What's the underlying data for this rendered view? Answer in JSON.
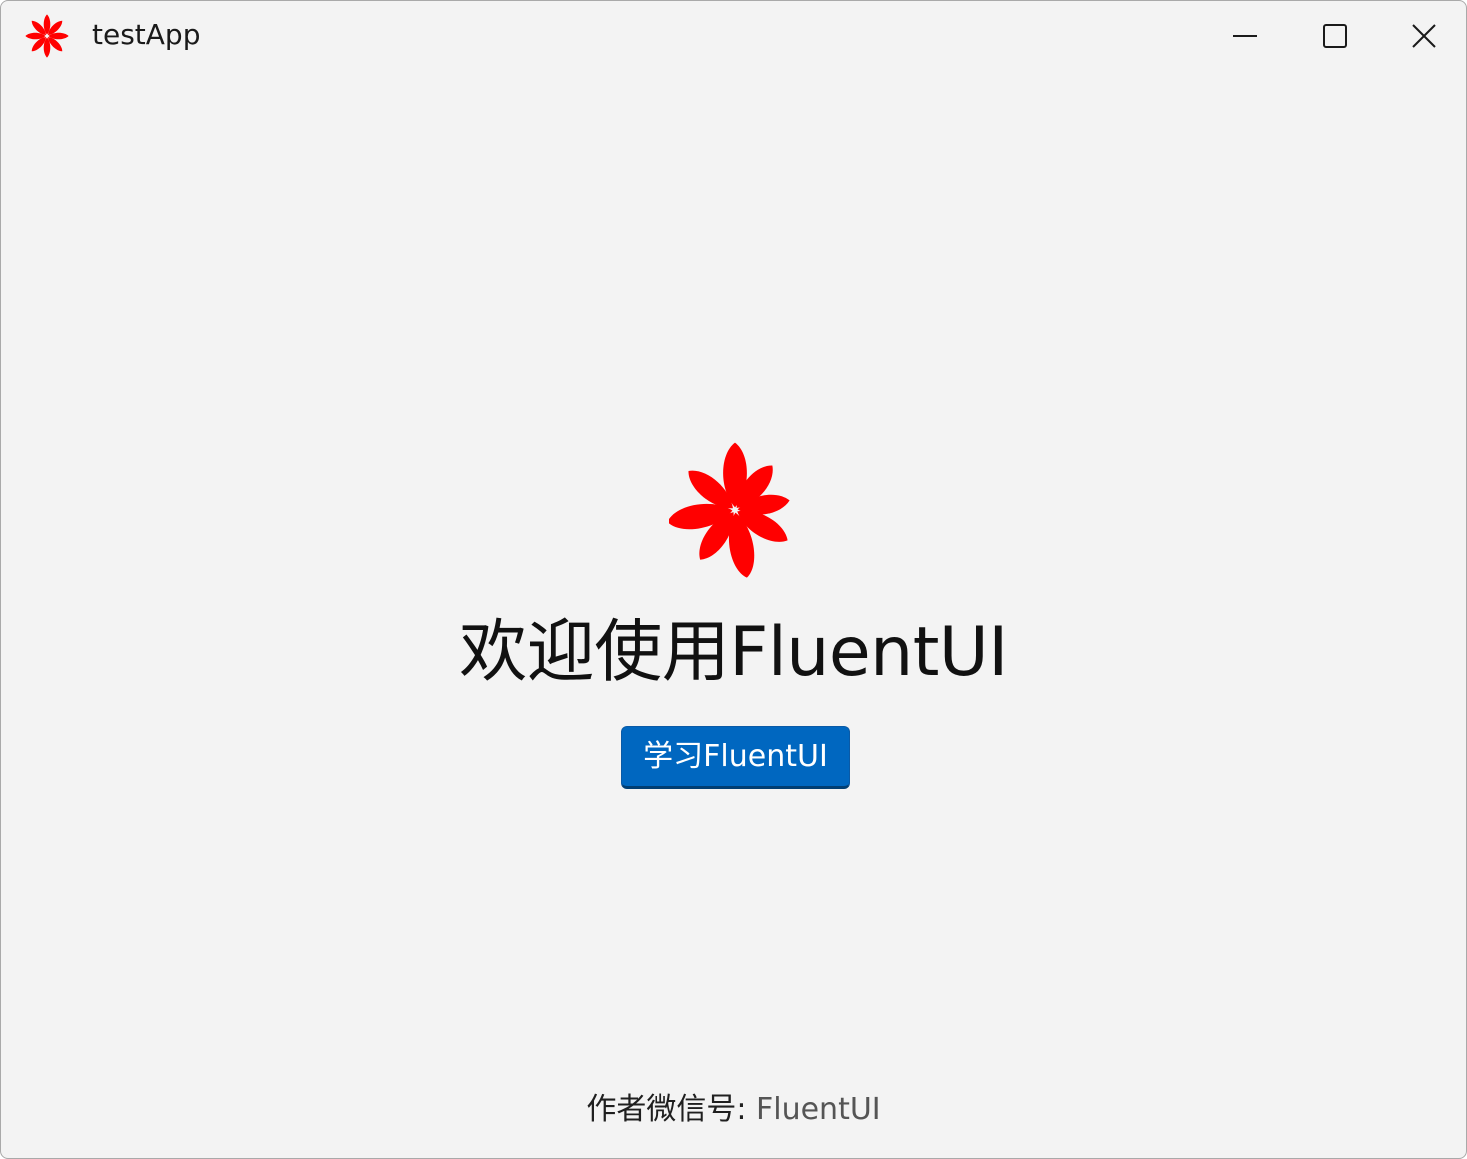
{
  "window": {
    "title": "testApp",
    "buttons": {
      "minimize": "minimize-icon",
      "maximize": "maximize-icon",
      "close": "close-icon"
    }
  },
  "main": {
    "logo_icon": "flower-logo-icon",
    "welcome_text": "欢迎使用FluentUI",
    "learn_button_label": "学习FluentUI"
  },
  "footer": {
    "label": "作者微信号: ",
    "value": "FluentUI"
  },
  "colors": {
    "background": "#f3f3f3",
    "accent": "#0067c0",
    "logo": "#ff0000"
  }
}
